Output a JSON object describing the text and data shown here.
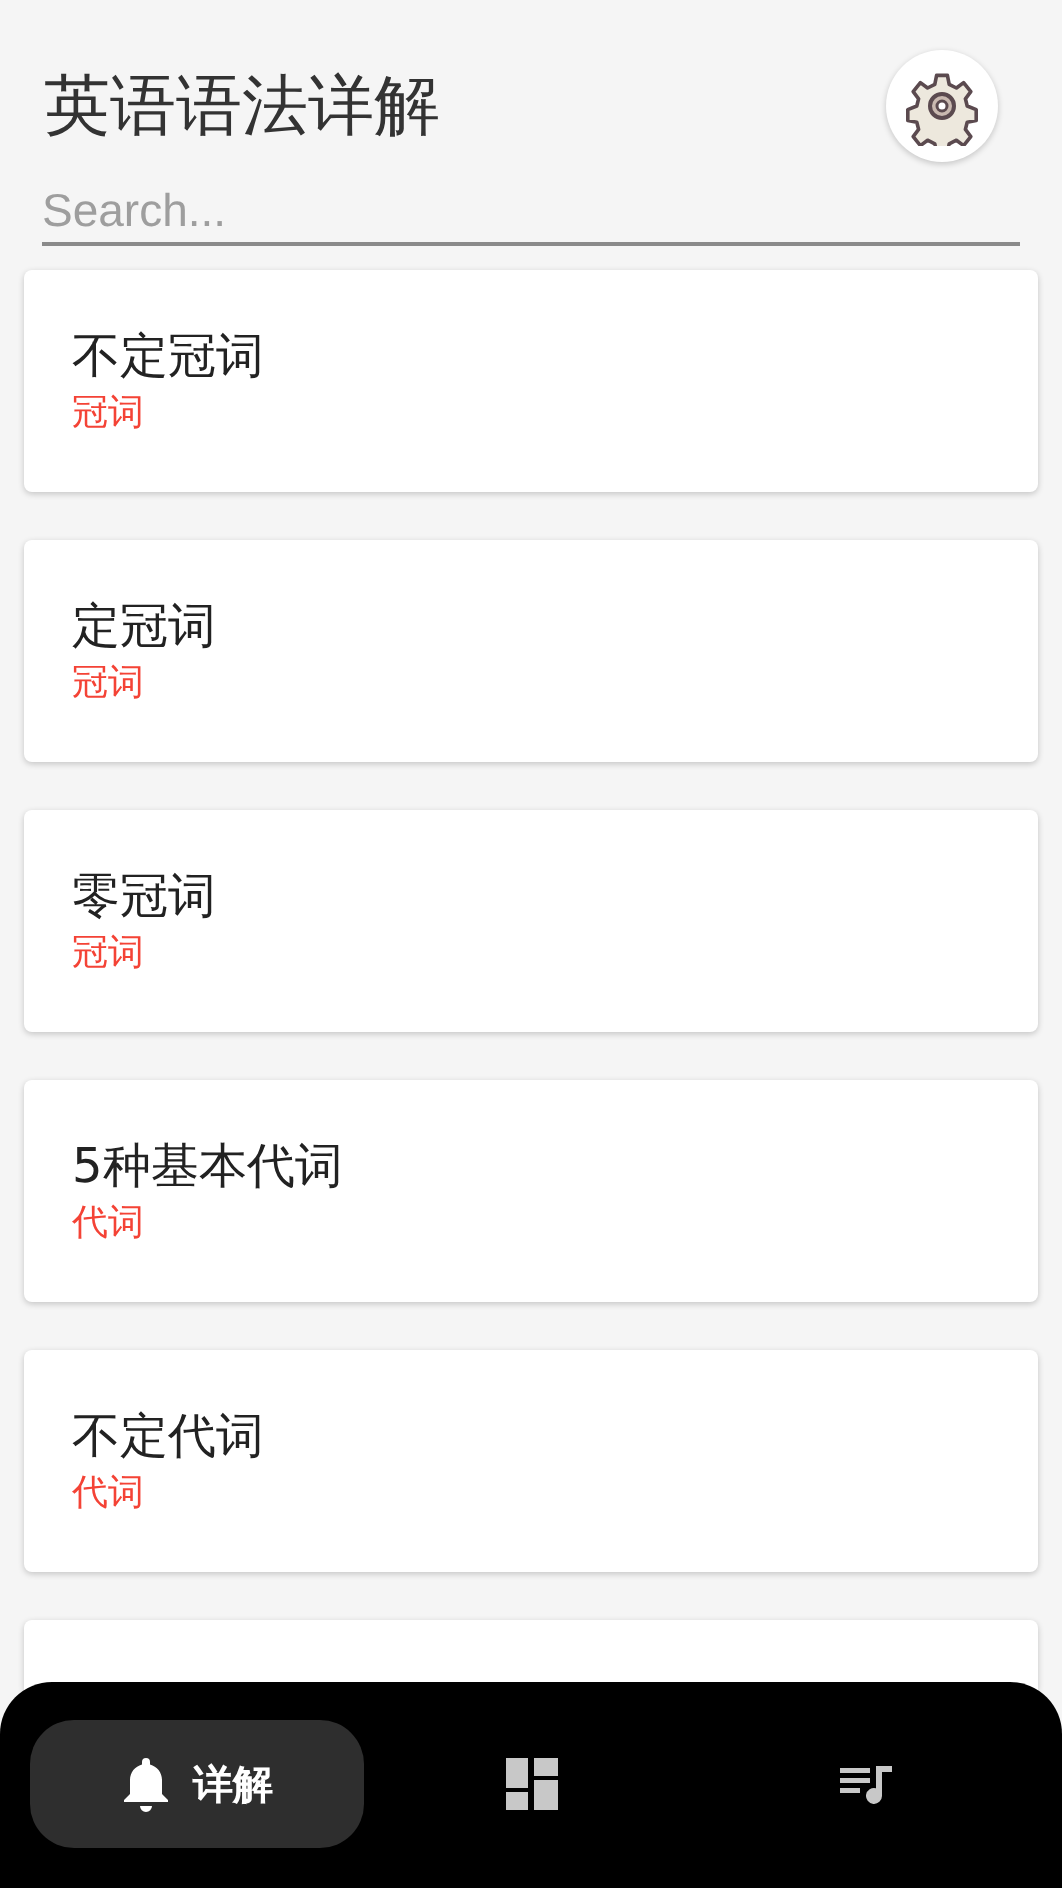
{
  "header": {
    "title": "英语语法详解"
  },
  "search": {
    "placeholder": "Search..."
  },
  "cards": [
    {
      "title": "不定冠词",
      "category": "冠词"
    },
    {
      "title": "定冠词",
      "category": "冠词"
    },
    {
      "title": "零冠词",
      "category": "冠词"
    },
    {
      "title": "5种基本代词",
      "category": "代词"
    },
    {
      "title": "不定代词",
      "category": "代词"
    }
  ],
  "nav": [
    {
      "label": "详解",
      "selected": true
    },
    {
      "selected": false
    },
    {
      "selected": false
    }
  ]
}
